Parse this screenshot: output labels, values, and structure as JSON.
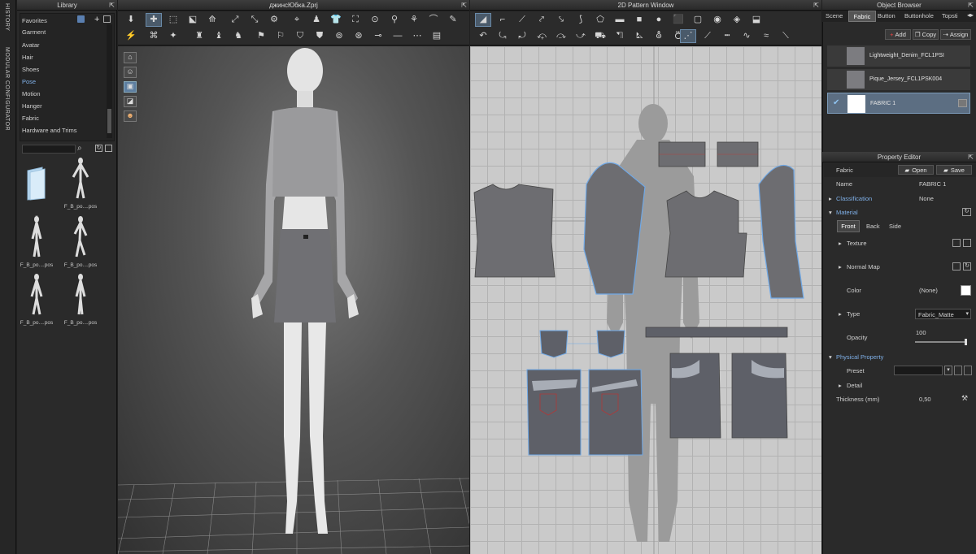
{
  "sidebar": {
    "history_label": "HISTORY",
    "modular_label": "MODULAR CONFIGURATOR"
  },
  "library": {
    "title": "Library",
    "categories": [
      "Favorites",
      "Garment",
      "Avatar",
      "Hair",
      "Shoes",
      "Pose",
      "Motion",
      "Hanger",
      "Fabric",
      "Hardware and Trims"
    ],
    "selected_category": "Pose",
    "search_value": "",
    "files": [
      {
        "name": ".."
      },
      {
        "name": "F_B_po....pos"
      },
      {
        "name": "F_B_po....pos"
      },
      {
        "name": "F_B_po....pos"
      },
      {
        "name": "F_B_po....pos"
      },
      {
        "name": "F_B_po....pos"
      }
    ]
  },
  "view3d": {
    "title": "джинсЮбка.Zprj"
  },
  "view2d": {
    "title": "2D Pattern Window"
  },
  "object_browser": {
    "title": "Object Browser",
    "tabs": [
      "Scene",
      "Fabric",
      "Button",
      "Buttonhole",
      "Topsti"
    ],
    "active_tab": "Fabric",
    "add_label": "Add",
    "copy_label": "Copy",
    "assign_label": "Assign",
    "fabrics": [
      {
        "name": "Lightweight_Denim_FCL1PSI",
        "selected": false
      },
      {
        "name": "Pique_Jersey_FCL1PSK004",
        "selected": false
      },
      {
        "name": "FABRIC 1",
        "selected": true
      }
    ]
  },
  "property_editor": {
    "title": "Property Editor",
    "fabric_label": "Fabric",
    "open_label": "Open",
    "save_label": "Save",
    "name_label": "Name",
    "name_value": "FABRIC 1",
    "classification_label": "Classification",
    "classification_value": "None",
    "material_label": "Material",
    "sides": [
      "Front",
      "Back",
      "Side"
    ],
    "active_side": "Front",
    "texture_label": "Texture",
    "normal_map_label": "Normal Map",
    "color_label": "Color",
    "color_value": "(None)",
    "type_label": "Type",
    "type_value": "Fabric_Matte",
    "opacity_label": "Opacity",
    "opacity_value": "100",
    "physical_label": "Physical Property",
    "preset_label": "Preset",
    "detail_label": "Detail",
    "thickness_label": "Thickness (mm)",
    "thickness_value": "0,50"
  },
  "colors": {
    "accent": "#6fa8e6",
    "panel_bg": "#2b2b2b",
    "viewport_bg": "#4a4a4a",
    "pattern_bg": "#c9c9c9",
    "fabric_piece": "#6b6b70",
    "denim_piece": "#5e6068"
  }
}
